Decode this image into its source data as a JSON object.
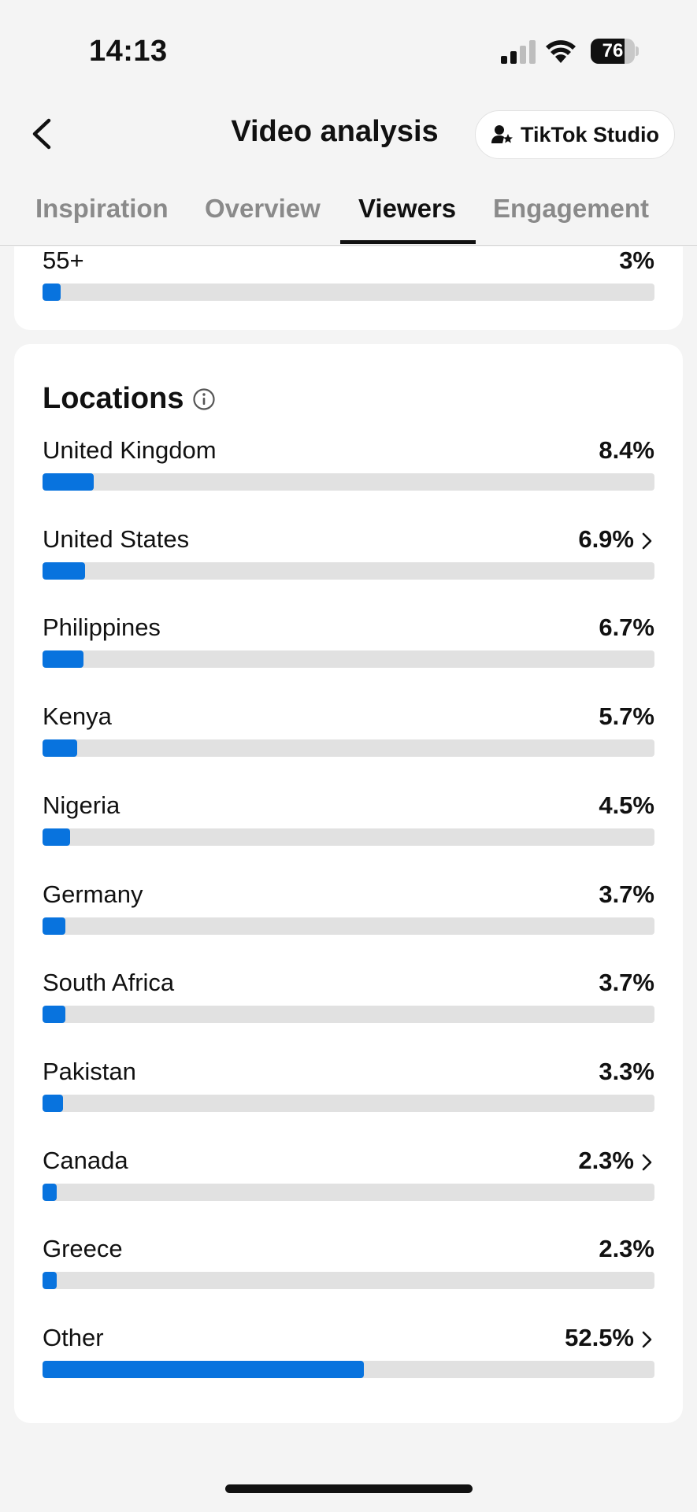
{
  "status_bar": {
    "time": "14:13",
    "battery": "76",
    "battery_level": 0.76
  },
  "header": {
    "title": "Video analysis",
    "studio_button_label": "TikTok Studio"
  },
  "tabs": [
    {
      "label": "Inspiration",
      "active": false
    },
    {
      "label": "Overview",
      "active": false
    },
    {
      "label": "Viewers",
      "active": true
    },
    {
      "label": "Engagement",
      "active": false
    }
  ],
  "age_partial": {
    "label": "55+",
    "value_label": "3%",
    "percent": 3
  },
  "locations": {
    "title": "Locations",
    "items": [
      {
        "label": "United Kingdom",
        "value_label": "8.4%",
        "percent": 8.4,
        "chevron": false
      },
      {
        "label": "United States",
        "value_label": "6.9%",
        "percent": 6.9,
        "chevron": true
      },
      {
        "label": "Philippines",
        "value_label": "6.7%",
        "percent": 6.7,
        "chevron": false
      },
      {
        "label": "Kenya",
        "value_label": "5.7%",
        "percent": 5.7,
        "chevron": false
      },
      {
        "label": "Nigeria",
        "value_label": "4.5%",
        "percent": 4.5,
        "chevron": false
      },
      {
        "label": "Germany",
        "value_label": "3.7%",
        "percent": 3.7,
        "chevron": false
      },
      {
        "label": "South Africa",
        "value_label": "3.7%",
        "percent": 3.7,
        "chevron": false
      },
      {
        "label": "Pakistan",
        "value_label": "3.3%",
        "percent": 3.3,
        "chevron": false
      },
      {
        "label": "Canada",
        "value_label": "2.3%",
        "percent": 2.3,
        "chevron": true
      },
      {
        "label": "Greece",
        "value_label": "2.3%",
        "percent": 2.3,
        "chevron": false
      },
      {
        "label": "Other",
        "value_label": "52.5%",
        "percent": 52.5,
        "chevron": true
      }
    ]
  },
  "colors": {
    "accent": "#0873de",
    "track": "#e1e1e1",
    "background": "#f4f4f4",
    "card": "#ffffff"
  },
  "icons": {
    "back": "chevron-left-icon",
    "studio": "user-star-icon",
    "info": "info-icon",
    "row_chevron": "chevron-right-icon"
  }
}
